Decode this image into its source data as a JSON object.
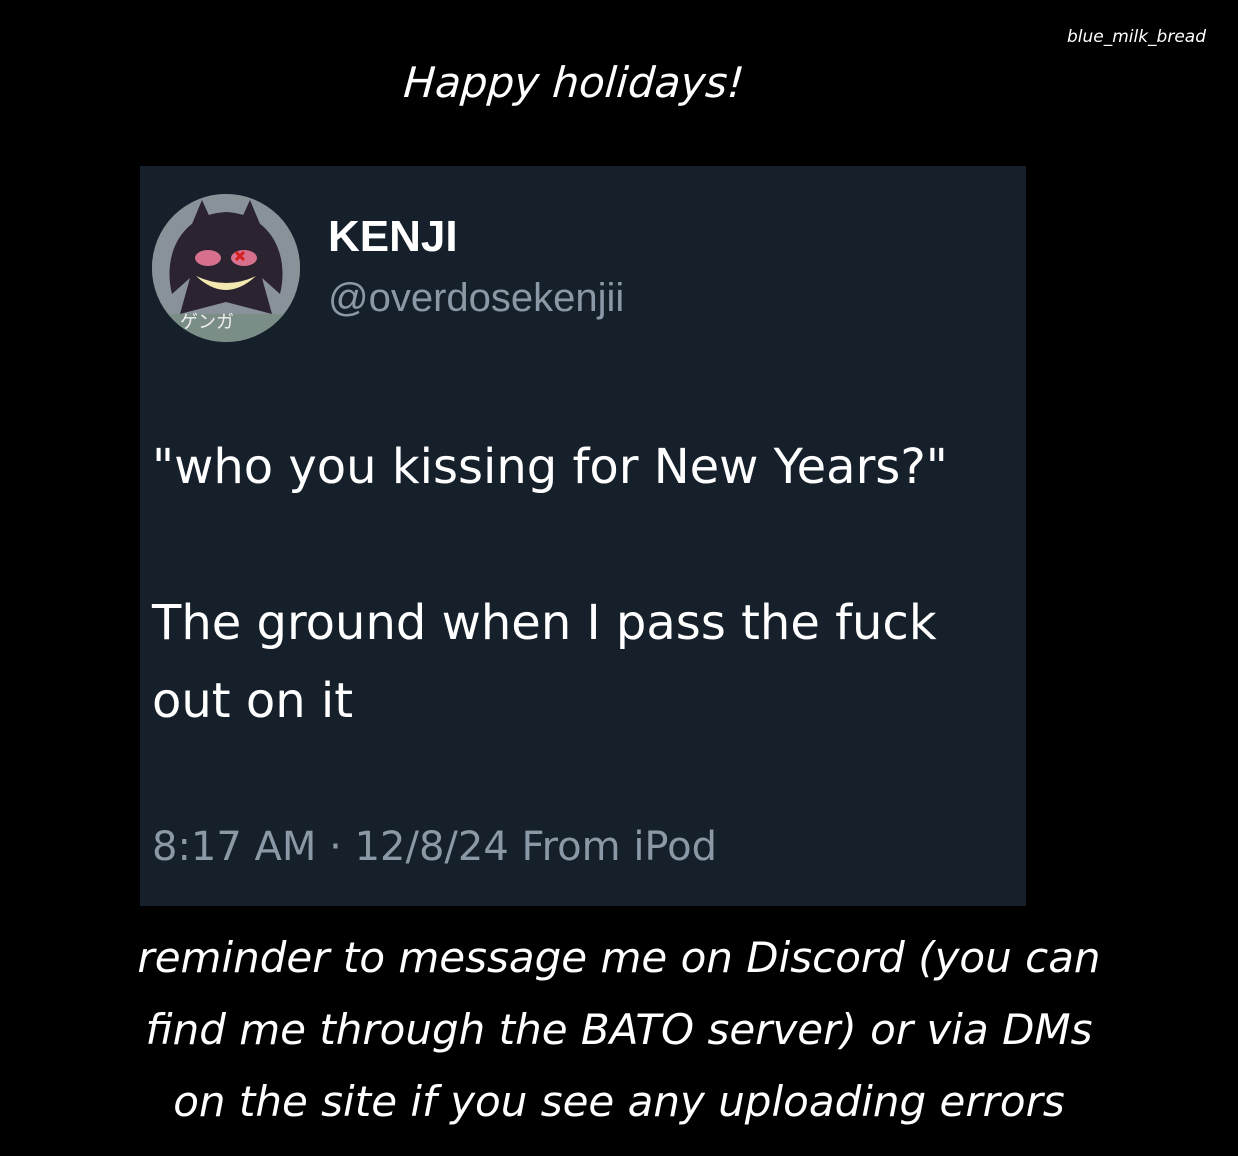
{
  "watermark": "blue_milk_bread",
  "header": "Happy holidays!",
  "tweet": {
    "display_name": "KENJI",
    "handle": "@overdosekenjii",
    "avatar_text": "ゲンガ",
    "text_lines": [
      "\"who you kissing for New Years?\"",
      "",
      "The ground when I pass the fuck",
      "out on it"
    ],
    "time": "8:17 AM",
    "separator": "·",
    "date": "12/8/24",
    "source": "From iPod"
  },
  "footer_lines": [
    "reminder to message me on Discord (you can",
    "find me through the BATO server) or via DMs",
    "on the site if you see any uploading errors"
  ],
  "colors": {
    "background": "#000000",
    "card": "#15202b",
    "secondary_text": "#8b98a5"
  }
}
